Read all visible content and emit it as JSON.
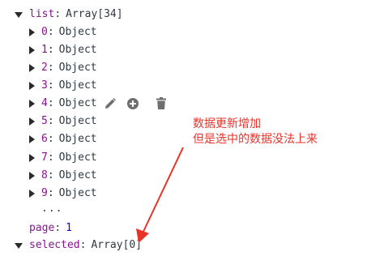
{
  "devtools": {
    "partial_top_text": "· · ·",
    "list": {
      "key": "list",
      "value": "Array[34]",
      "items": [
        {
          "index": "0",
          "value": "Object"
        },
        {
          "index": "1",
          "value": "Object"
        },
        {
          "index": "2",
          "value": "Object"
        },
        {
          "index": "3",
          "value": "Object"
        },
        {
          "index": "4",
          "value": "Object"
        },
        {
          "index": "5",
          "value": "Object"
        },
        {
          "index": "6",
          "value": "Object"
        },
        {
          "index": "7",
          "value": "Object"
        },
        {
          "index": "8",
          "value": "Object"
        },
        {
          "index": "9",
          "value": "Object"
        }
      ],
      "more": "..."
    },
    "page": {
      "key": "page",
      "value": "1"
    },
    "selected": {
      "key": "selected",
      "value": "Array[0]"
    },
    "row_actions": [
      "edit-icon",
      "add-icon",
      "delete-icon"
    ]
  },
  "annotation": {
    "line1": "数据更新增加",
    "line2": "但是选中的数据没法上来",
    "color": "#e8332a"
  }
}
